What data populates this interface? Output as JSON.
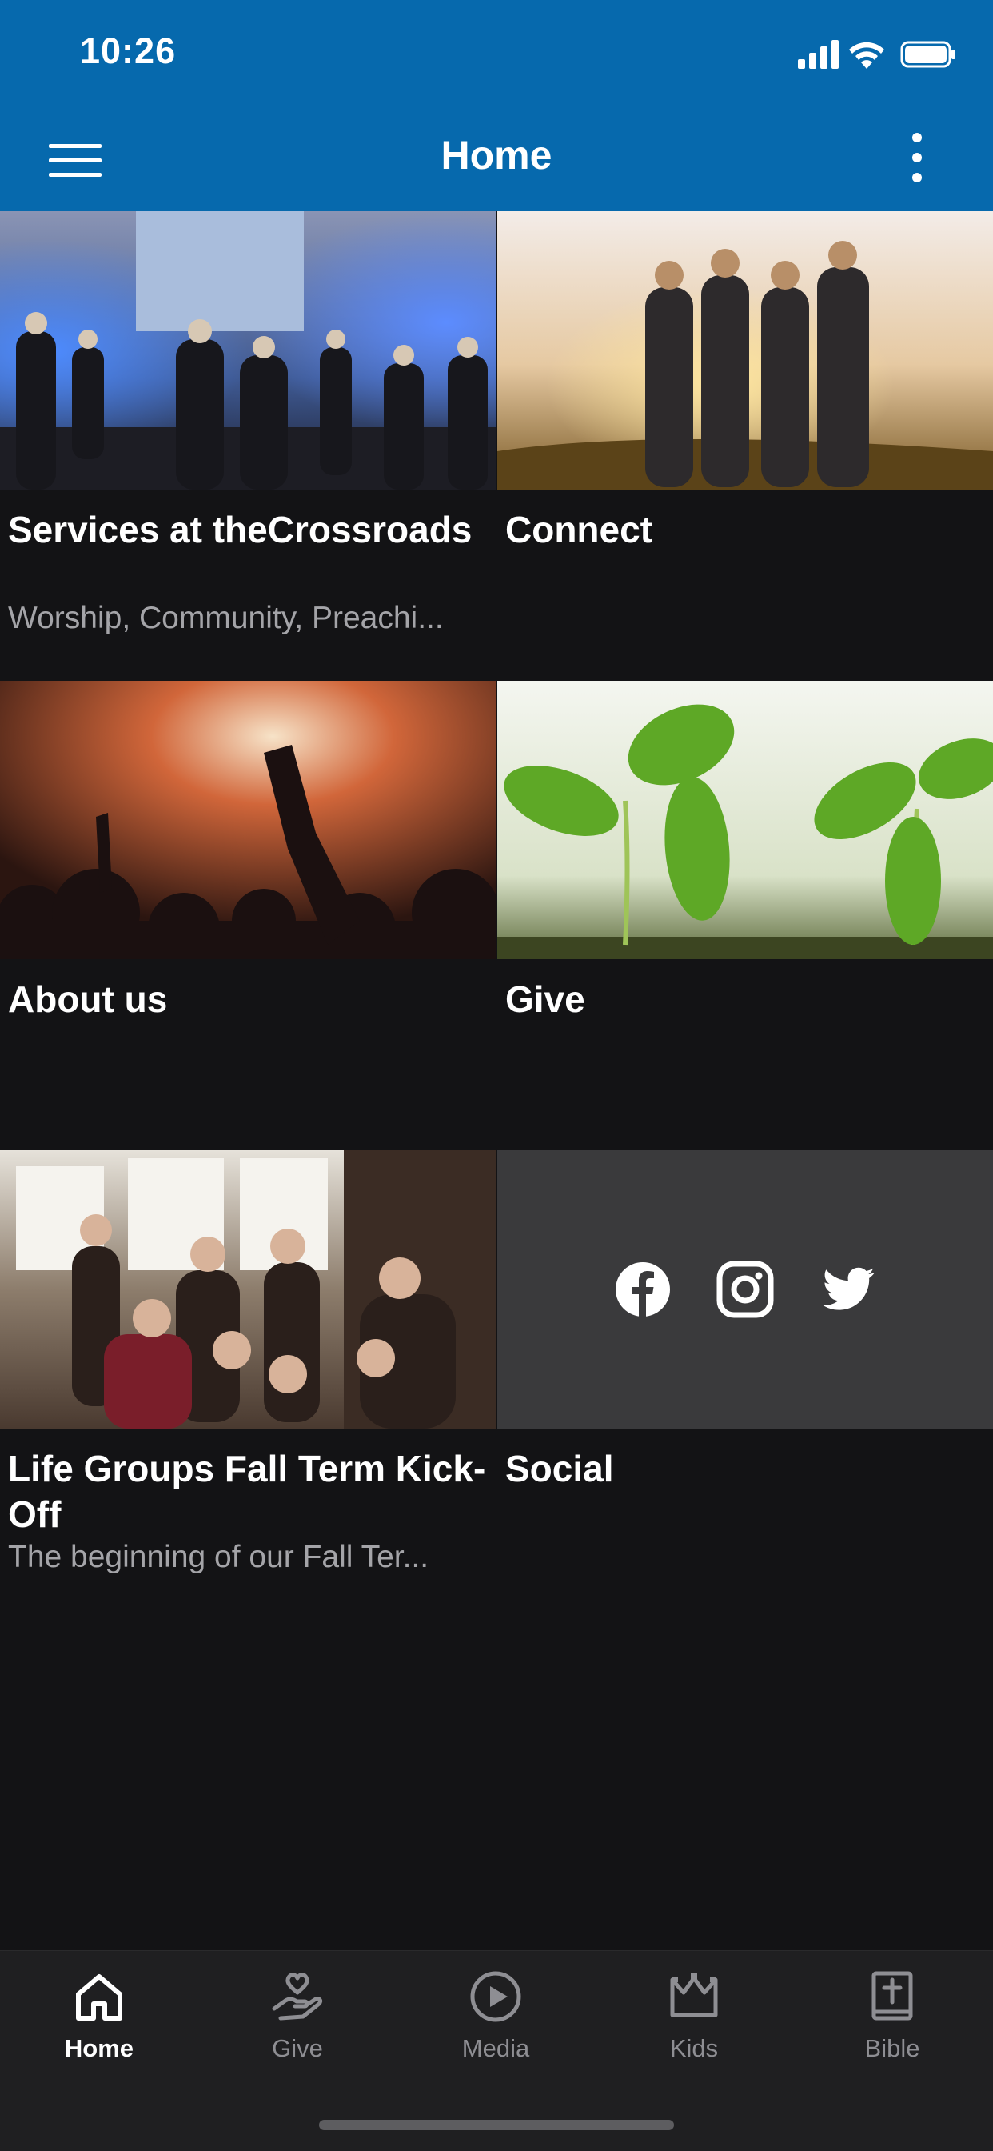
{
  "status_bar": {
    "time": "10:26"
  },
  "header": {
    "title": "Home"
  },
  "tiles": [
    {
      "title": "Services at theCrossroads",
      "subtitle": "Worship, Community, Preachi..."
    },
    {
      "title": "Connect",
      "subtitle": ""
    },
    {
      "title": "About us",
      "subtitle": ""
    },
    {
      "title": "Give",
      "subtitle": ""
    },
    {
      "title": "Life Groups Fall Term Kick-Off",
      "subtitle": "The beginning of our Fall Ter..."
    },
    {
      "title": "Social",
      "subtitle": ""
    }
  ],
  "social_icons": [
    "facebook-icon",
    "instagram-icon",
    "twitter-icon"
  ],
  "tabs": [
    {
      "label": "Home",
      "icon": "home-icon",
      "active": true
    },
    {
      "label": "Give",
      "icon": "give-hand-heart-icon",
      "active": false
    },
    {
      "label": "Media",
      "icon": "play-circle-icon",
      "active": false
    },
    {
      "label": "Kids",
      "icon": "crown-icon",
      "active": false
    },
    {
      "label": "Bible",
      "icon": "bible-cross-icon",
      "active": false
    }
  ],
  "colors": {
    "header_bg": "#0669ad",
    "page_bg": "#131315",
    "tabbar_bg": "#1f1f21",
    "social_tile_bg": "#3a3a3c",
    "tab_active": "#ffffff",
    "tab_inactive": "#8e8e93",
    "subtitle": "#a4a4a8"
  }
}
